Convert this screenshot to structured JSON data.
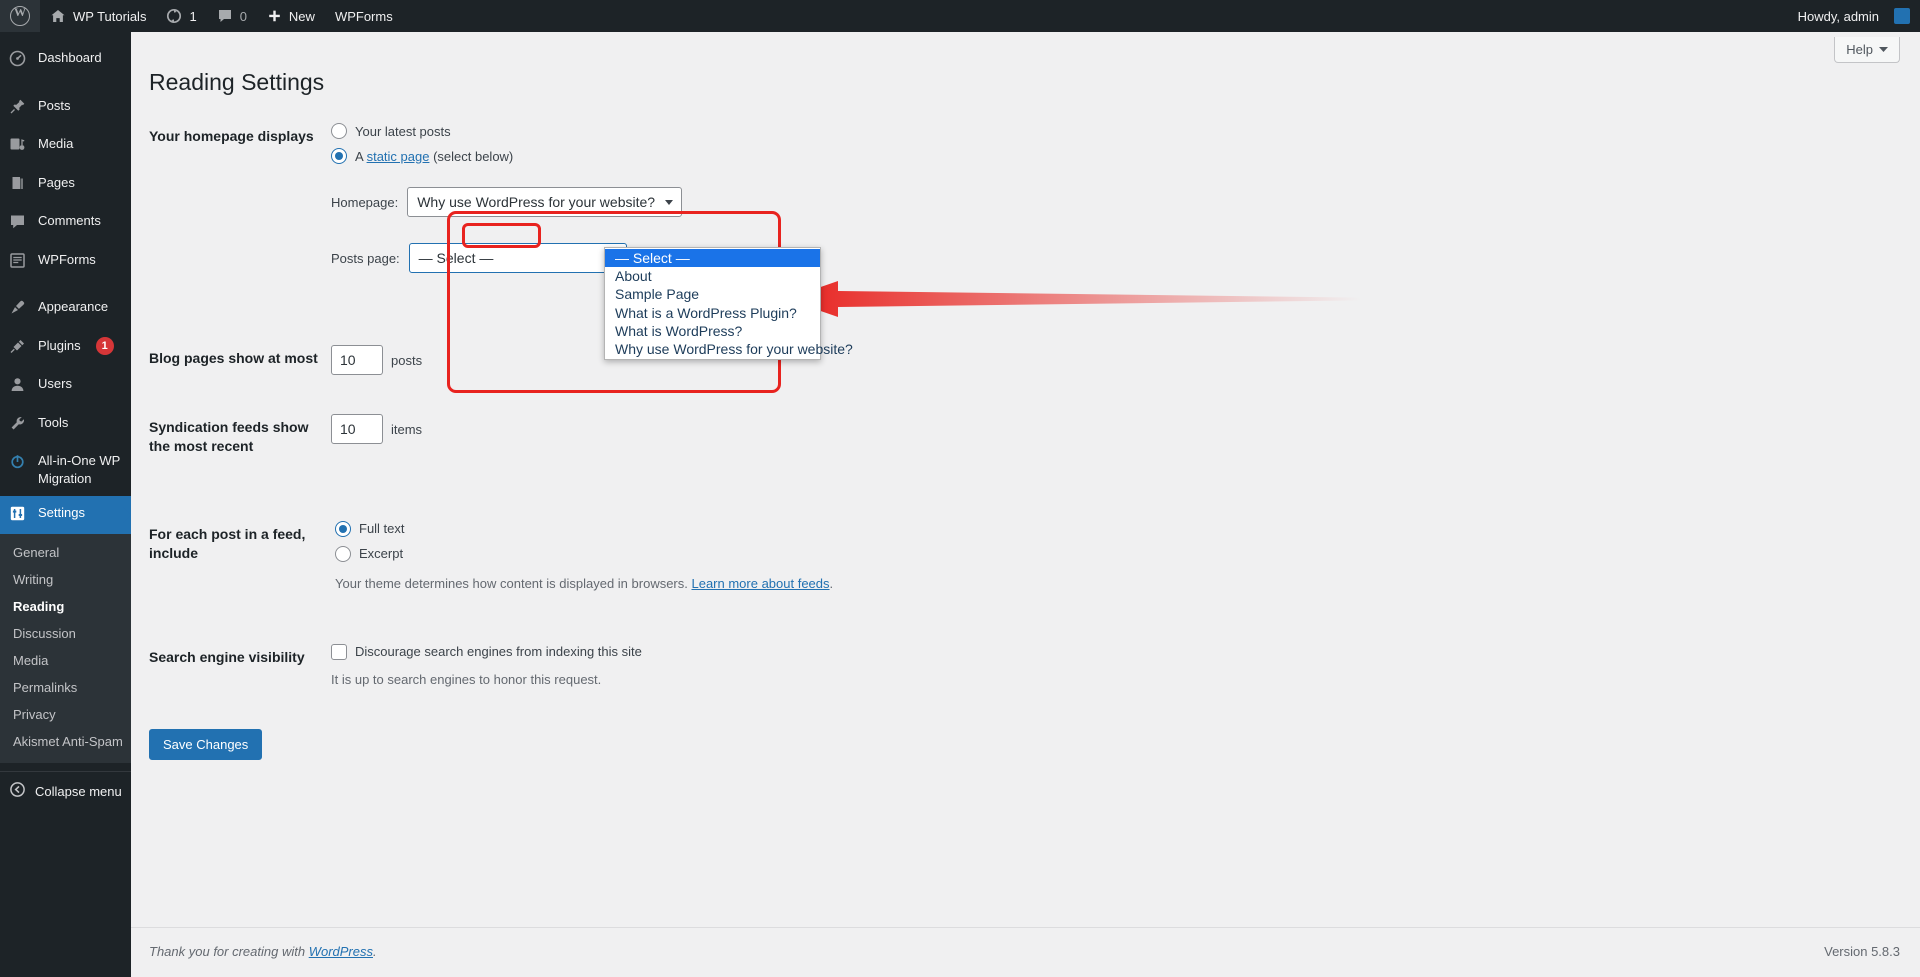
{
  "adminbar": {
    "logo_icon": "wordpress-logo-icon",
    "site_name": "WP Tutorials",
    "site_icon": "home-icon",
    "updates_icon": "updates-icon",
    "updates_count": "1",
    "comments_icon": "comment-bubble-icon",
    "comments_count": "0",
    "new_icon": "plus-icon",
    "new_label": "New",
    "wpforms_label": "WPForms",
    "howdy": "Howdy, admin",
    "avatar": "user-avatar"
  },
  "sidebar": {
    "items": [
      {
        "label": "Dashboard",
        "icon": "dashboard-icon"
      },
      {
        "label": "Posts",
        "icon": "pin-icon"
      },
      {
        "label": "Media",
        "icon": "media-icon"
      },
      {
        "label": "Pages",
        "icon": "pages-icon"
      },
      {
        "label": "Comments",
        "icon": "comment-bubble-icon"
      },
      {
        "label": "WPForms",
        "icon": "wpforms-icon"
      },
      {
        "label": "Appearance",
        "icon": "brush-icon"
      },
      {
        "label": "Plugins",
        "icon": "plug-icon",
        "badge": "1"
      },
      {
        "label": "Users",
        "icon": "user-icon"
      },
      {
        "label": "Tools",
        "icon": "wrench-icon"
      },
      {
        "label": "All-in-One WP Migration",
        "icon": "migration-icon"
      },
      {
        "label": "Settings",
        "icon": "settings-sliders-icon",
        "current": true
      }
    ],
    "submenu": [
      {
        "label": "General"
      },
      {
        "label": "Writing"
      },
      {
        "label": "Reading",
        "current": true
      },
      {
        "label": "Discussion"
      },
      {
        "label": "Media"
      },
      {
        "label": "Permalinks"
      },
      {
        "label": "Privacy"
      },
      {
        "label": "Akismet Anti-Spam"
      }
    ],
    "collapse_label": "Collapse menu",
    "collapse_icon": "collapse-arrow-icon"
  },
  "page": {
    "title": "Reading Settings",
    "help_label": "Help",
    "help_caret": "chevron-down-icon"
  },
  "form": {
    "homepage_displays": {
      "label": "Your homepage displays",
      "option_latest": "Your latest posts",
      "option_static_prefix": "A ",
      "option_static_link": "static page",
      "option_static_suffix": " (select below)",
      "selected": "static"
    },
    "homepage_select": {
      "label": "Homepage:",
      "value": "Why use WordPress for your website?"
    },
    "posts_page_select": {
      "label": "Posts page:",
      "value": "— Select —",
      "open": true,
      "options": [
        "— Select —",
        "About",
        "Sample Page",
        "What is a WordPress Plugin?",
        "What is WordPress?",
        "Why use WordPress for your website?"
      ],
      "highlighted_index": 0
    },
    "blog_pages": {
      "label": "Blog pages show at most",
      "value": "10",
      "unit": "posts"
    },
    "syndication": {
      "label": "Syndication feeds show the most recent",
      "value": "10",
      "unit": "items"
    },
    "feed_include": {
      "label": "For each post in a feed, include",
      "option_full": "Full text",
      "option_excerpt": "Excerpt",
      "selected": "full",
      "description_prefix": "Your theme determines how content is displayed in browsers. ",
      "description_link": "Learn more about feeds",
      "description_suffix": "."
    },
    "search_visibility": {
      "label": "Search engine visibility",
      "checkbox_label": "Discourage search engines from indexing this site",
      "checked": false,
      "note": "It is up to search engines to honor this request."
    },
    "save_label": "Save Changes"
  },
  "footer": {
    "thanks_prefix": "Thank you for creating with ",
    "thanks_link": "WordPress",
    "thanks_suffix": ".",
    "version": "Version 5.8.3"
  },
  "colors": {
    "admin_dark": "#1d2327",
    "accent_blue": "#2271b1",
    "annotation_red": "#e8231f",
    "badge_red": "#d63638",
    "dropdown_highlight": "#1a73e8"
  }
}
